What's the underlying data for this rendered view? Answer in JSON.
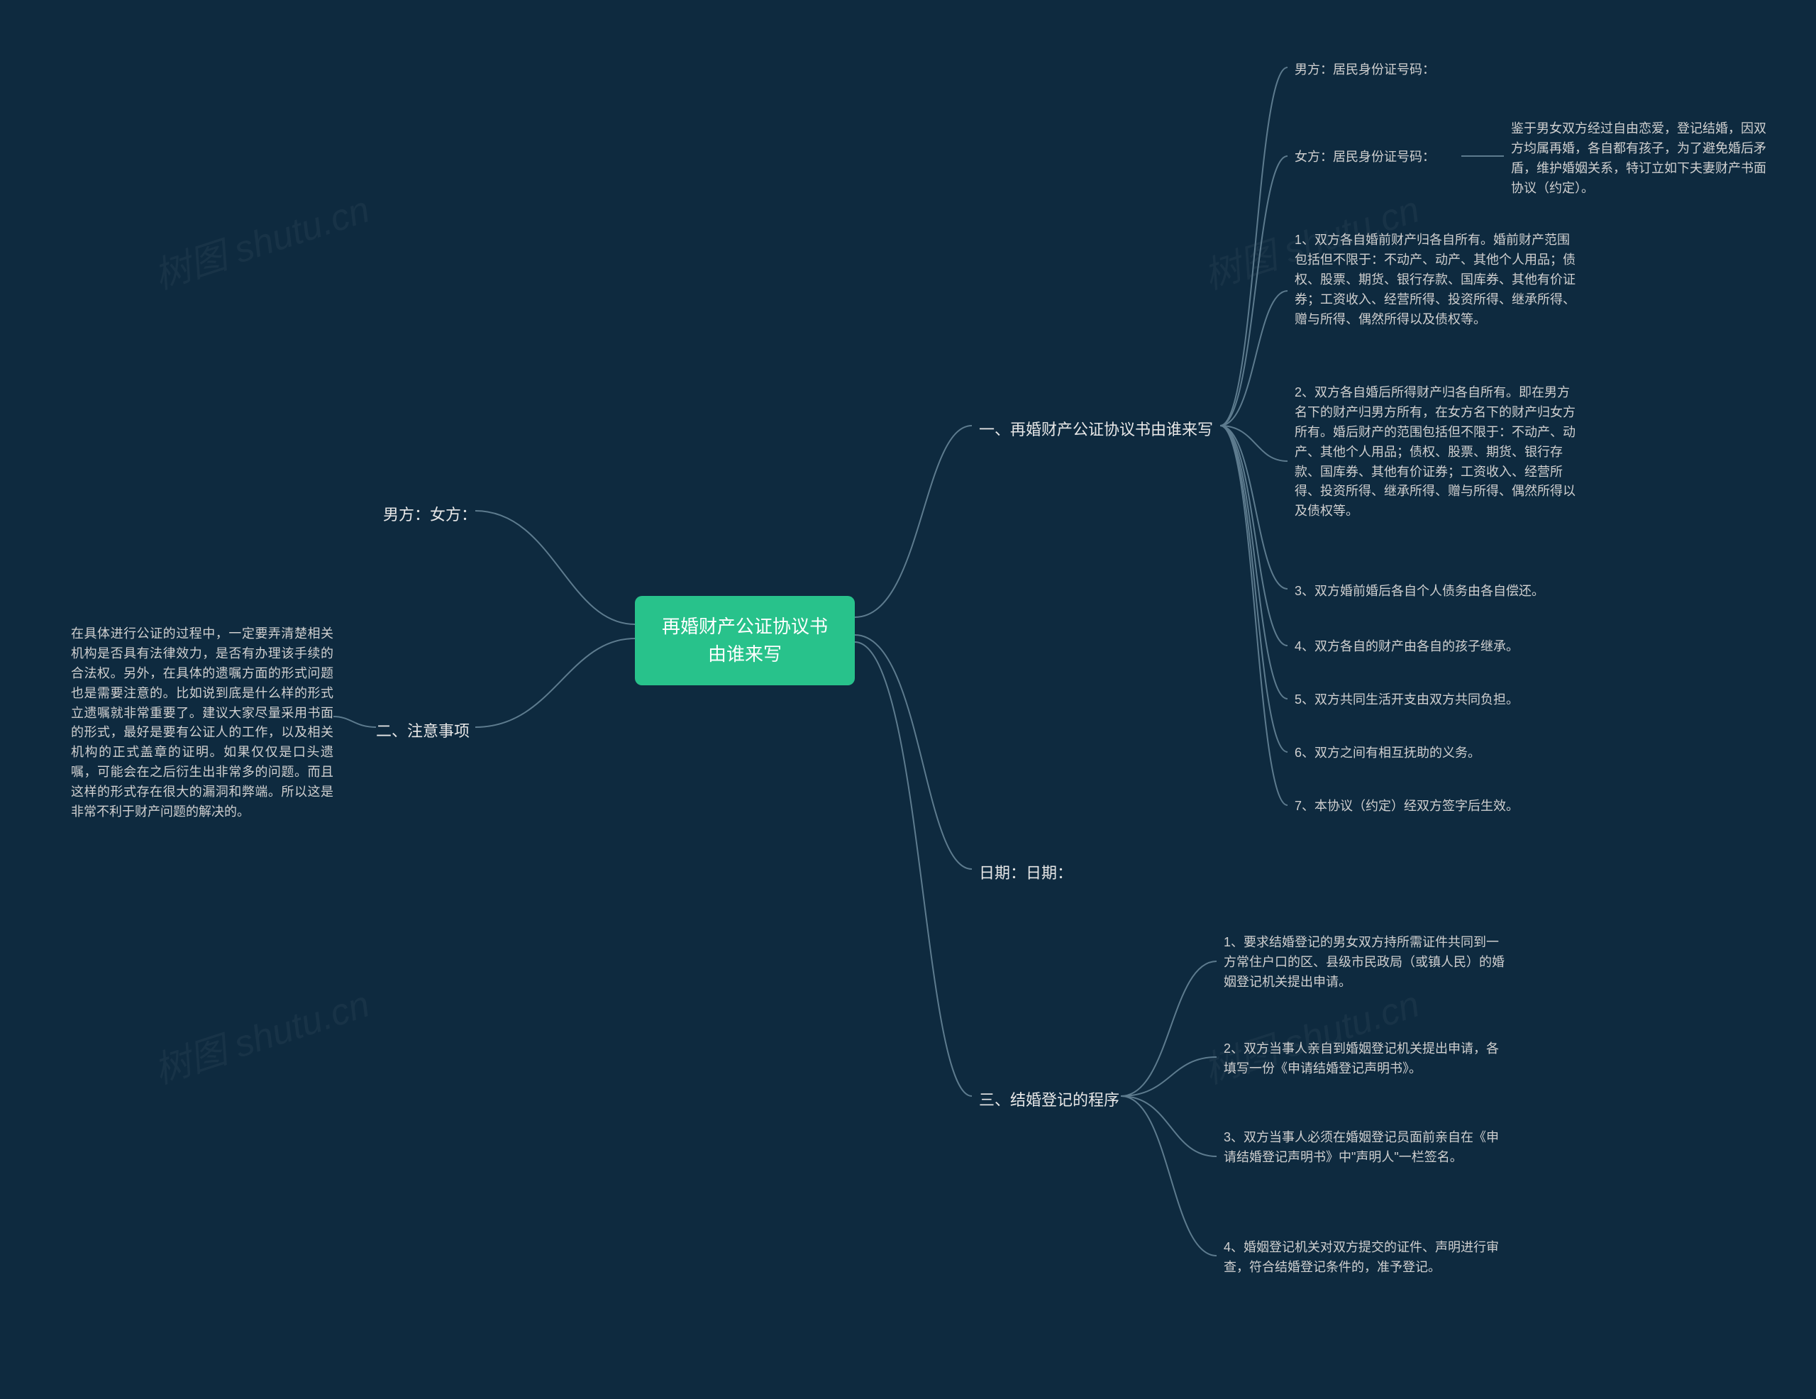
{
  "watermark_text": "树图 shutu.cn",
  "root": {
    "title": "再婚财产公证协议书由谁来写"
  },
  "left": {
    "b1": {
      "label": "男方：女方："
    },
    "b2": {
      "label": "二、注意事项",
      "content": "在具体进行公证的过程中，一定要弄清楚相关机构是否具有法律效力，是否有办理该手续的合法权。另外，在具体的遗嘱方面的形式问题也是需要注意的。比如说到底是什么样的形式立遗嘱就非常重要了。建议大家尽量采用书面的形式，最好是要有公证人的工作，以及相关机构的正式盖章的证明。如果仅仅是口头遗嘱，可能会在之后衍生出非常多的问题。而且这样的形式存在很大的漏洞和弊端。所以这是非常不利于财产问题的解决的。"
    }
  },
  "right": {
    "b1": {
      "label": "一、再婚财产公证协议书由谁来写",
      "children": {
        "c1": "男方：居民身份证号码：",
        "c2": {
          "label": "女方：居民身份证号码：",
          "content": "鉴于男女双方经过自由恋爱，登记结婚，因双方均属再婚，各自都有孩子，为了避免婚后矛盾，维护婚姻关系，特订立如下夫妻财产书面协议（约定）。"
        },
        "c3": "1、双方各自婚前财产归各自所有。婚前财产范围包括但不限于：不动产、动产、其他个人用品；债权、股票、期货、银行存款、国库券、其他有价证券；工资收入、经营所得、投资所得、继承所得、赠与所得、偶然所得以及债权等。",
        "c4": "2、双方各自婚后所得财产归各自所有。即在男方名下的财产归男方所有，在女方名下的财产归女方所有。婚后财产的范围包括但不限于：不动产、动产、其他个人用品；债权、股票、期货、银行存款、国库券、其他有价证券；工资收入、经营所得、投资所得、继承所得、赠与所得、偶然所得以及债权等。",
        "c5": "3、双方婚前婚后各自个人债务由各自偿还。",
        "c6": "4、双方各自的财产由各自的孩子继承。",
        "c7": "5、双方共同生活开支由双方共同负担。",
        "c8": "6、双方之间有相互抚助的义务。",
        "c9": "7、本协议（约定）经双方签字后生效。"
      }
    },
    "b2": {
      "label": "日期：日期："
    },
    "b3": {
      "label": "三、结婚登记的程序",
      "children": {
        "c1": "1、要求结婚登记的男女双方持所需证件共同到一方常住户口的区、县级市民政局（或镇人民）的婚姻登记机关提出申请。",
        "c2": "2、双方当事人亲自到婚姻登记机关提出申请，各填写一份《申请结婚登记声明书》。",
        "c3": "3、双方当事人必须在婚姻登记员面前亲自在《申请结婚登记声明书》中\"声明人\"一栏签名。",
        "c4": "4、婚姻登记机关对双方提交的证件、声明进行审查，符合结婚登记条件的，准予登记。"
      }
    }
  }
}
